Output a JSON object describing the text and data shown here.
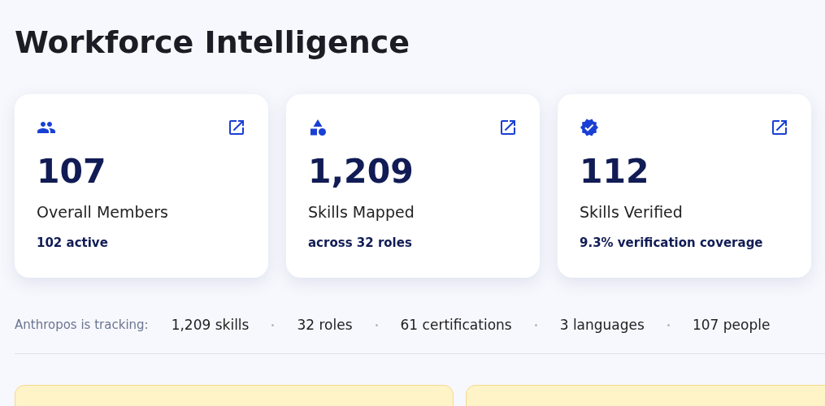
{
  "title": "Workforce Intelligence",
  "stats": [
    {
      "value": "107",
      "label": "Overall Members",
      "detail": "102 active"
    },
    {
      "value": "1,209",
      "label": "Skills Mapped",
      "detail": "across 32 roles"
    },
    {
      "value": "112",
      "label": "Skills Verified",
      "detail": "9.3% verification coverage"
    }
  ],
  "tracking": {
    "label": "Anthropos is tracking:",
    "items": [
      "1,209 skills",
      "32 roles",
      "61 certifications",
      "3 languages",
      "107 people"
    ]
  },
  "alerts": [
    {
      "kind": "warning"
    },
    {
      "kind": "warning"
    }
  ]
}
